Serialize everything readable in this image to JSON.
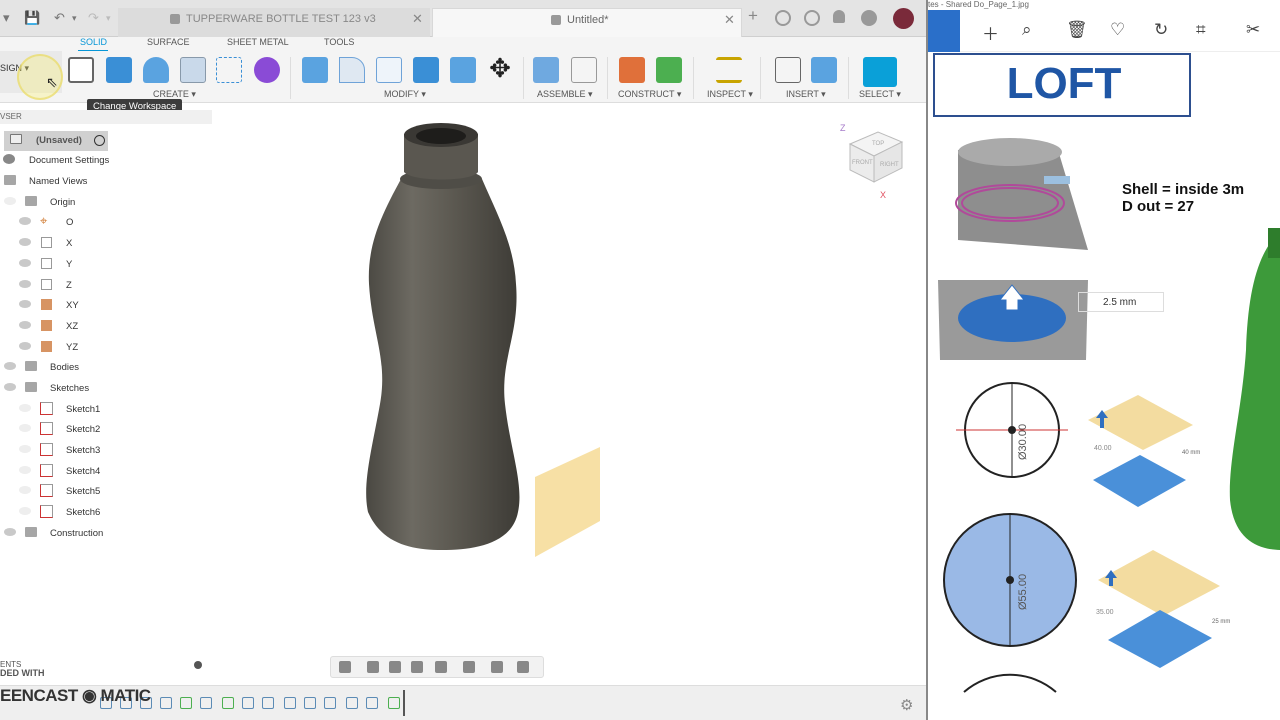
{
  "title_bar": {
    "tab1_label": "TUPPERWARE BOTTLE TEST 123 v3",
    "tab2_label": "Untitled*",
    "close_glyph": "✕",
    "new_tab_glyph": "+"
  },
  "ribbon": {
    "tabs": [
      "SOLID",
      "SURFACE",
      "SHEET METAL",
      "TOOLS"
    ],
    "groups": [
      "CREATE ▾",
      "MODIFY ▾",
      "ASSEMBLE ▾",
      "CONSTRUCT ▾",
      "INSPECT ▾",
      "INSERT ▾",
      "SELECT ▾"
    ],
    "workspace_label": "SIGN ▾",
    "tooltip": "Change Workspace"
  },
  "browser": {
    "header": "VSER",
    "items": [
      {
        "label": "(Unsaved)"
      },
      {
        "label": "Document Settings"
      },
      {
        "label": "Named Views"
      },
      {
        "label": "Origin"
      },
      {
        "label": "O"
      },
      {
        "label": "X"
      },
      {
        "label": "Y"
      },
      {
        "label": "Z"
      },
      {
        "label": "XY"
      },
      {
        "label": "XZ"
      },
      {
        "label": "YZ"
      },
      {
        "label": "Bodies"
      },
      {
        "label": "Sketches"
      },
      {
        "label": "Sketch1"
      },
      {
        "label": "Sketch2"
      },
      {
        "label": "Sketch3"
      },
      {
        "label": "Sketch4"
      },
      {
        "label": "Sketch5"
      },
      {
        "label": "Sketch6"
      },
      {
        "label": "Construction"
      }
    ]
  },
  "bottom": {
    "comments_label": "ENTS",
    "watermark_top": "DED WITH",
    "watermark_main": "EENCAST ◉ MATIC"
  },
  "viewcube": {
    "top": "TOP",
    "front": "FRONT",
    "right": "RIGHT",
    "z": "Z",
    "x": "X"
  },
  "viewer": {
    "top_text": "tes - Shared Do_Page_1.jpg",
    "heading": "LOFT",
    "shell_line1": "Shell = inside 3m",
    "shell_line2": "D out = 27",
    "field_value": "2.5 mm",
    "dim1": "Ø30.00",
    "dim2": "Ø55.00",
    "dim3": "40.00",
    "dim4": "35.00",
    "dim5": "40 mm",
    "dim6": "25 mm"
  },
  "colors": {
    "accent": "#0696d7",
    "bottle": "#5d5a52",
    "plane": "#f6dd9b",
    "loft_text": "#1f56a5"
  }
}
